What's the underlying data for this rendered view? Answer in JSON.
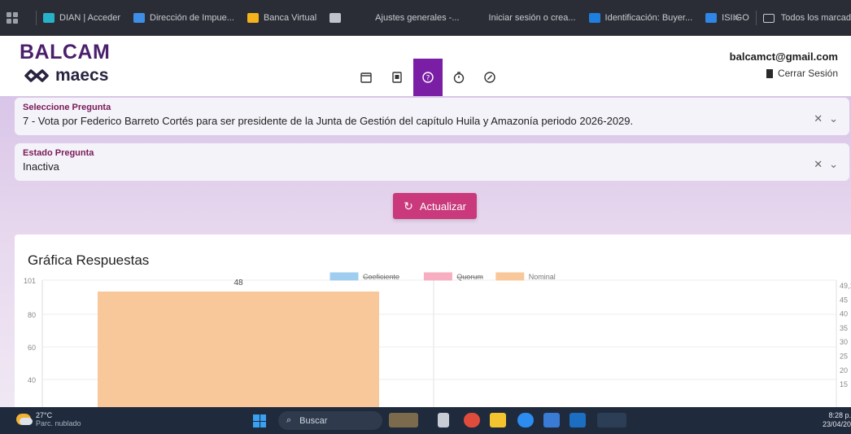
{
  "bookmarks": {
    "items": [
      {
        "label": "DIAN | Acceder",
        "color": "#26b3c9"
      },
      {
        "label": "Dirección de Impue...",
        "color": "#3e8ee8"
      },
      {
        "label": "Banca Virtual",
        "color": "#f5b21a"
      },
      {
        "label": "",
        "color": "#bfc3ca"
      },
      {
        "label": "Ajustes generales -...",
        "color": "#2b2d36"
      },
      {
        "label": "Iniciar sesión o crea...",
        "color": "#2b2d36"
      },
      {
        "label": "Identificación: Buyer...",
        "color": "#1f7fe0"
      },
      {
        "label": "ISIIGO",
        "color": "#2f86e6"
      }
    ],
    "overflow": "»",
    "all_bookmarks": "Todos los marcad"
  },
  "header": {
    "brand_top": "BALCAM",
    "brand_bottom": "maecs",
    "nav_icons": [
      "calendar-icon",
      "document-icon",
      "help-icon",
      "timer-icon",
      "check-circle-icon"
    ],
    "active_nav": 2,
    "user_email": "balcamct@gmail.com",
    "logout_label": "Cerrar Sesión",
    "accent": "#7a1fa5"
  },
  "form": {
    "question_label": "Seleccione Pregunta",
    "question_value": "7 - Vota por Federico Barreto Cortés para ser presidente de la Junta de Gestión del capítulo Huila y Amazonía periodo 2026-2029.",
    "status_label": "Estado Pregunta",
    "status_value": "Inactiva",
    "clear_glyph": "✕",
    "expand_glyph": "⌄",
    "update_button": "Actualizar",
    "button_color": "#c9397b"
  },
  "chart_card": {
    "title": "Gráfica Respuestas"
  },
  "chart_data": {
    "type": "bar",
    "title": "Gráfica Respuestas",
    "series": [
      {
        "name": "Coeficiente",
        "color": "#9fcdf0",
        "values": [
          null
        ],
        "hidden": true
      },
      {
        "name": "Quorum",
        "color": "#f7aec1",
        "values": [
          null
        ],
        "hidden": true
      },
      {
        "name": "Nominal",
        "color": "#f8c89a",
        "values": [
          48
        ]
      }
    ],
    "data_label": "48",
    "legend_placement": "top",
    "y_left": {
      "max": 101,
      "ticks": [
        "101",
        "80",
        "60",
        "40"
      ]
    },
    "y_right": {
      "ticks": [
        "49,1",
        "45",
        "40",
        "35",
        "30",
        "25",
        "20",
        "15"
      ]
    },
    "grid": true
  },
  "taskbar": {
    "temperature": "27°C",
    "weather_desc": "Parc. nublado",
    "search_placeholder": "Buscar",
    "time": "8:28 p.",
    "date": "23/04/20"
  }
}
